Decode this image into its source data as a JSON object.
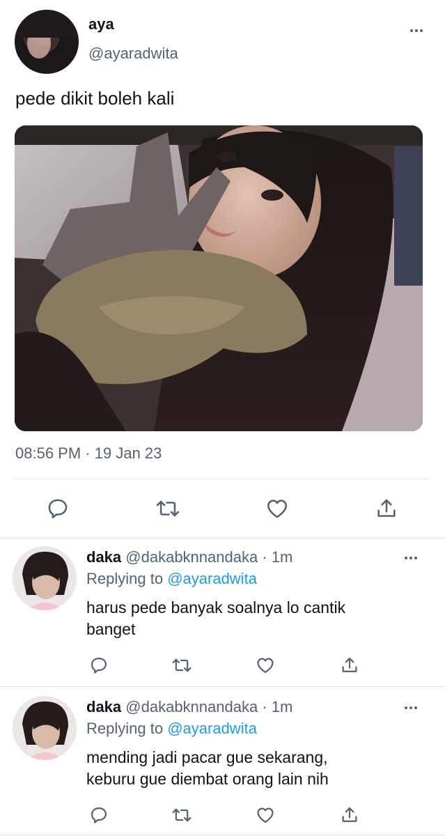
{
  "tweet": {
    "author_name": "aya",
    "author_handle": "@ayaradwita",
    "text": "pede dikit boleh kali",
    "time": "08:56 PM",
    "sep": "·",
    "date": "19 Jan 23"
  },
  "replies": [
    {
      "name": "daka",
      "handle": "@dakabknnandaka",
      "sep": "·",
      "age": "1m",
      "replying_prefix": "Replying to",
      "replying_to": "@ayaradwita",
      "text_line1": "harus pede banyak soalnya lo cantik",
      "text_line2": "banget"
    },
    {
      "name": "daka",
      "handle": "@dakabknnandaka",
      "sep": "·",
      "age": "1m",
      "replying_prefix": "Replying to",
      "replying_to": "@ayaradwita",
      "text_line1": "mending jadi pacar gue sekarang,",
      "text_line2": "keburu gue diembat orang lain nih"
    }
  ],
  "icons": [
    "more-icon",
    "reply-icon",
    "retweet-icon",
    "like-icon",
    "share-icon"
  ],
  "colors": {
    "text": "#0f1419",
    "muted": "#536471",
    "link": "#1d9bf0",
    "divider": "#e1e4e8"
  }
}
